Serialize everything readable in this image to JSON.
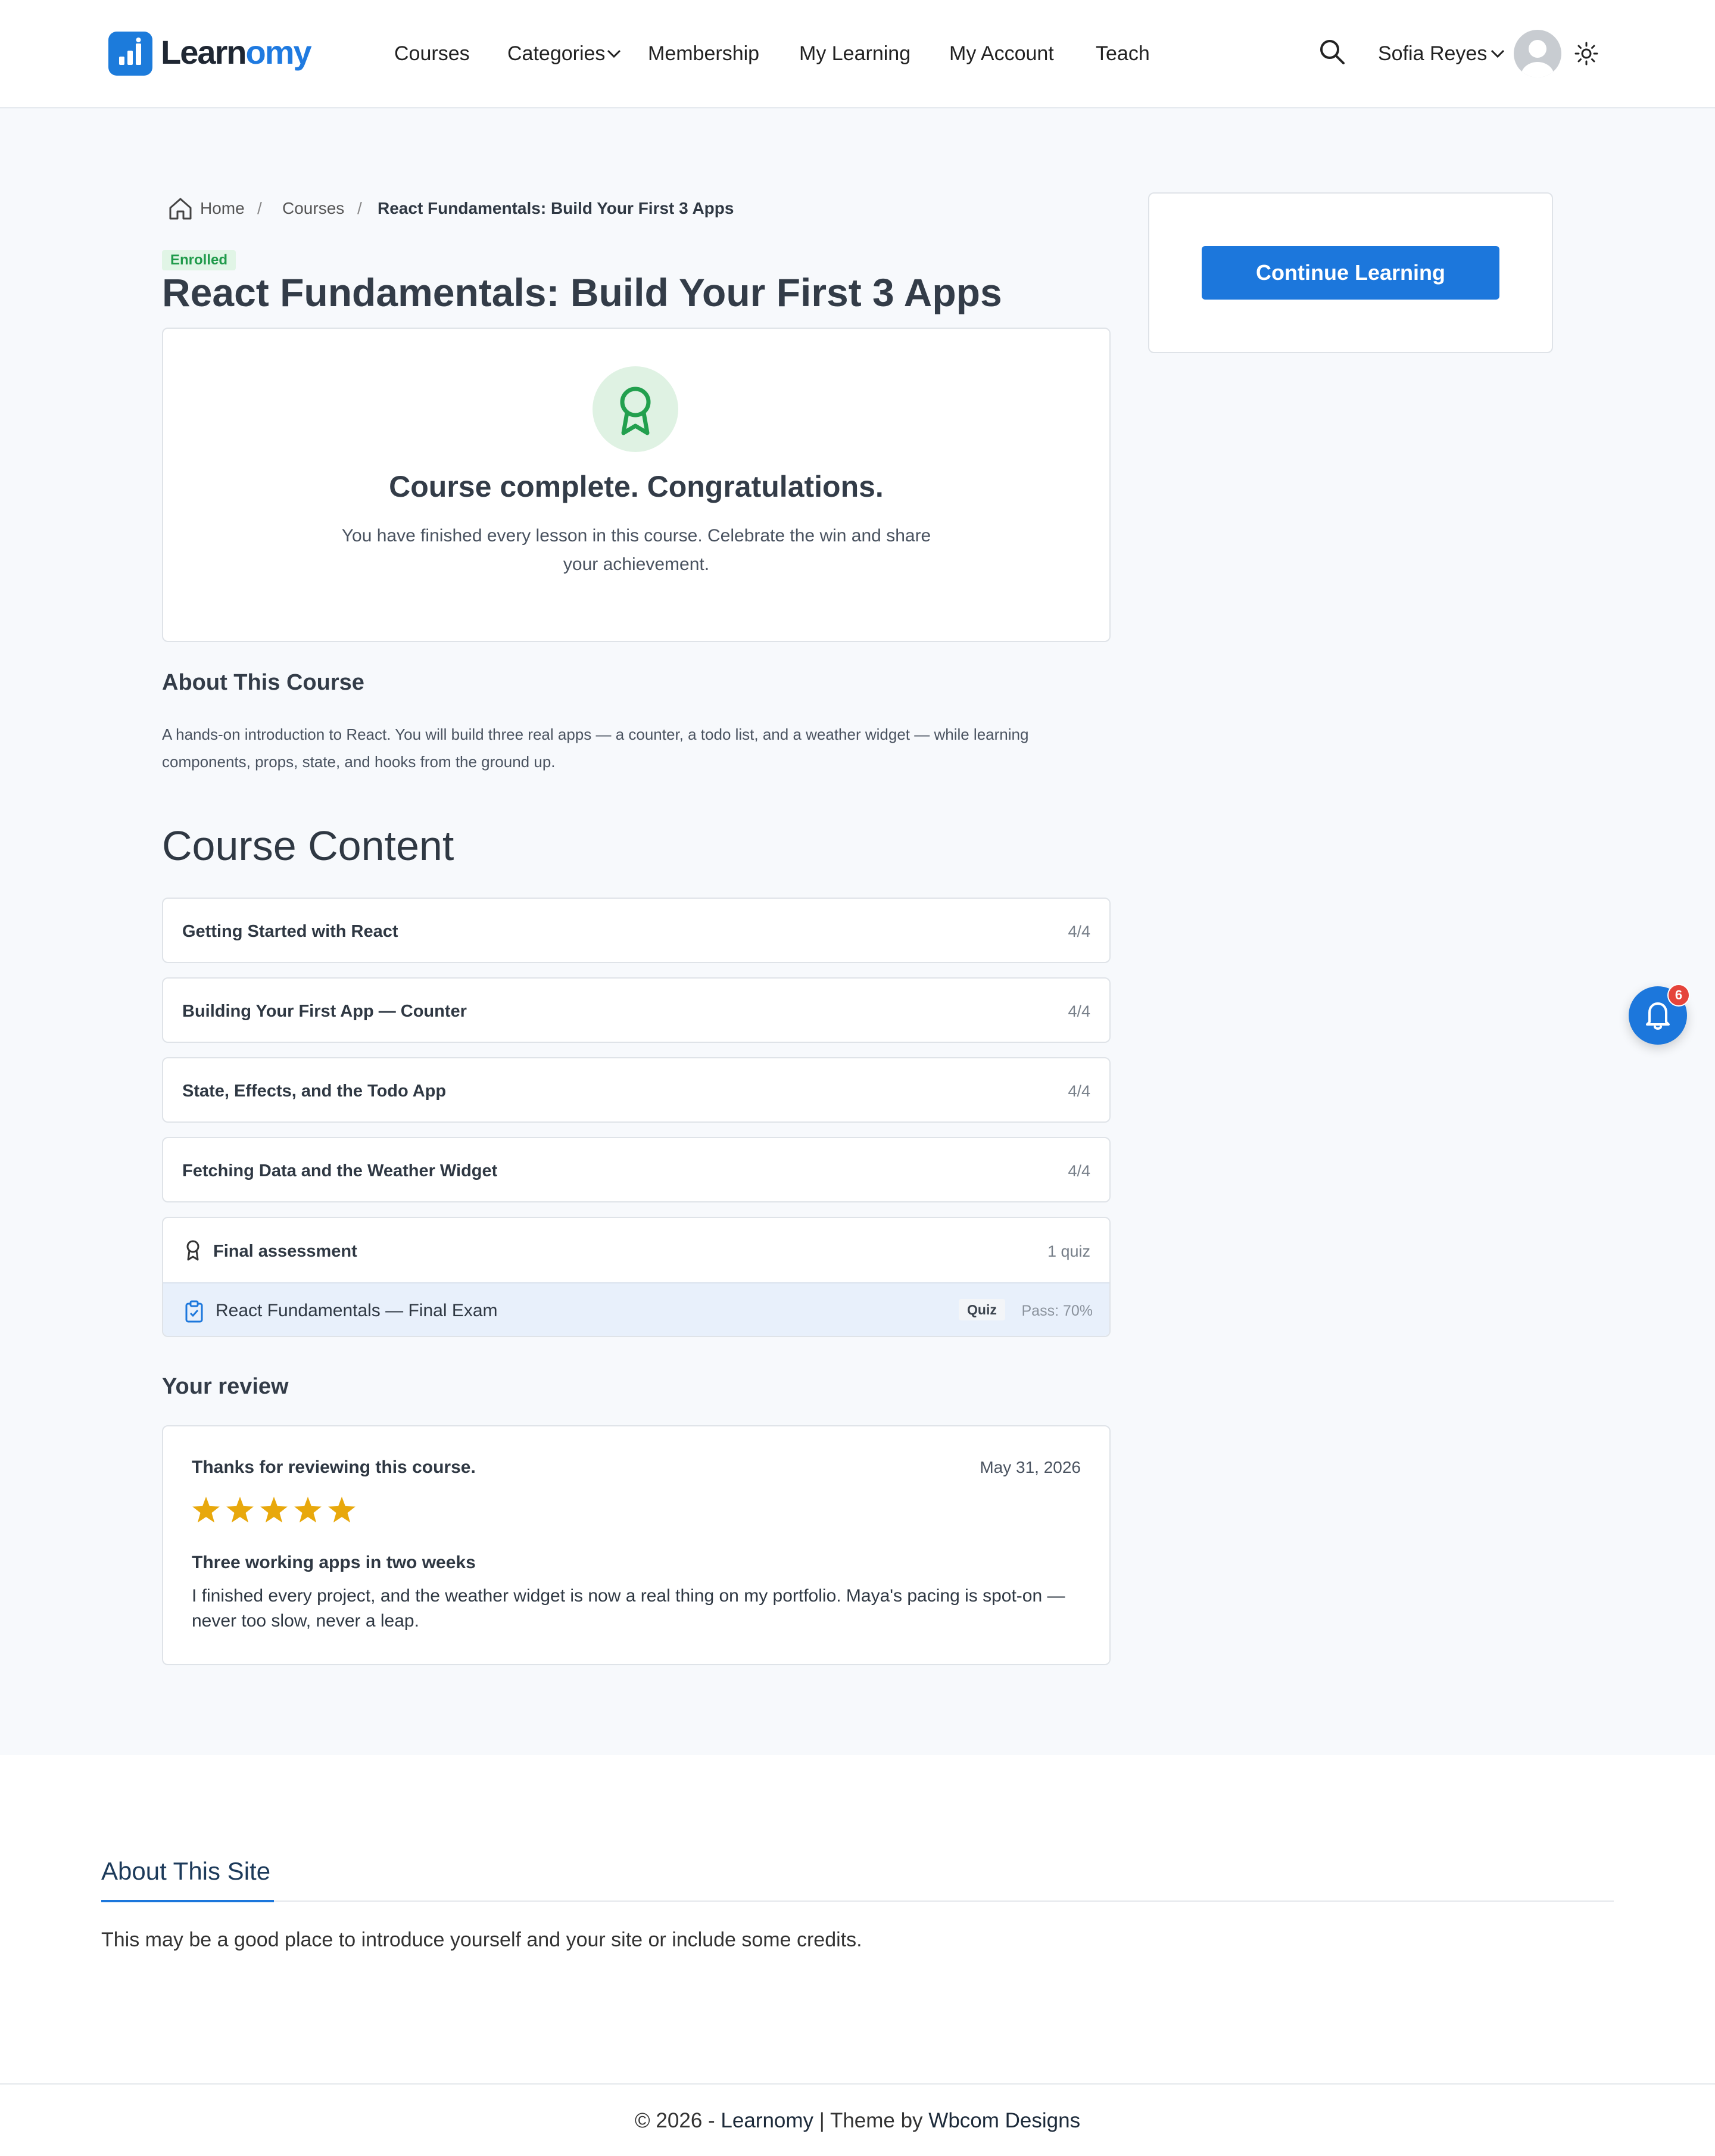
{
  "header": {
    "logo_part1": "Learn",
    "logo_part2": "omy",
    "nav": [
      "Courses",
      "Categories",
      "Membership",
      "My Learning",
      "My Account",
      "Teach"
    ],
    "user_name": "Sofia Reyes",
    "icons": {
      "search": "search-icon",
      "theme": "sun-icon",
      "dropdown": "chevron-down-icon"
    }
  },
  "breadcrumb": [
    "Home",
    "Courses",
    "React Fundamentals: Build Your First 3 Apps"
  ],
  "course": {
    "status_badge": "Enrolled",
    "title": "React Fundamentals: Build Your First 3 Apps",
    "complete_title": "Course complete. Congratulations.",
    "complete_desc": "You have finished every lesson in this course. Celebrate the win and share your achievement.",
    "about_heading": "About This Course",
    "about_desc": "A hands-on introduction to React. You will build three real apps — a counter, a todo list, and a weather widget — while learning components, props, state, and hooks from the ground up.",
    "content_heading": "Course Content",
    "sections": [
      {
        "title": "Getting Started with React",
        "count": "4/4"
      },
      {
        "title": "Building Your First App — Counter",
        "count": "4/4"
      },
      {
        "title": "State, Effects, and the Todo App",
        "count": "4/4"
      },
      {
        "title": "Fetching Data and the Weather Widget",
        "count": "4/4"
      }
    ],
    "final": {
      "title": "Final assessment",
      "count": "1 quiz",
      "lesson": "React Fundamentals — Final Exam",
      "tag": "Quiz",
      "pass": "Pass: 70%"
    }
  },
  "review": {
    "heading": "Your review",
    "thanks": "Thanks for reviewing this course.",
    "date": "May 31, 2026",
    "rating": 5,
    "rating_max": 5,
    "title": "Three working apps in two weeks",
    "body": "I finished every project, and the weather widget is now a real thing on my portfolio. Maya's pacing is spot-on — never too slow, never a leap."
  },
  "sidebar": {
    "continue_label": "Continue Learning"
  },
  "notifications": {
    "count": "6"
  },
  "footer": {
    "about_heading": "About This Site",
    "about_text": "This may be a good place to introduce yourself and your site or include some credits.",
    "copyright_prefix": "© 2026 - ",
    "site_link": "Learnomy",
    "separator": " | Theme by ",
    "theme_link": "Wbcom Designs"
  },
  "colors": {
    "accent": "#1c77dc",
    "success": "#1f9a4a",
    "star": "#e8a80c",
    "badge_red": "#e5443b"
  }
}
